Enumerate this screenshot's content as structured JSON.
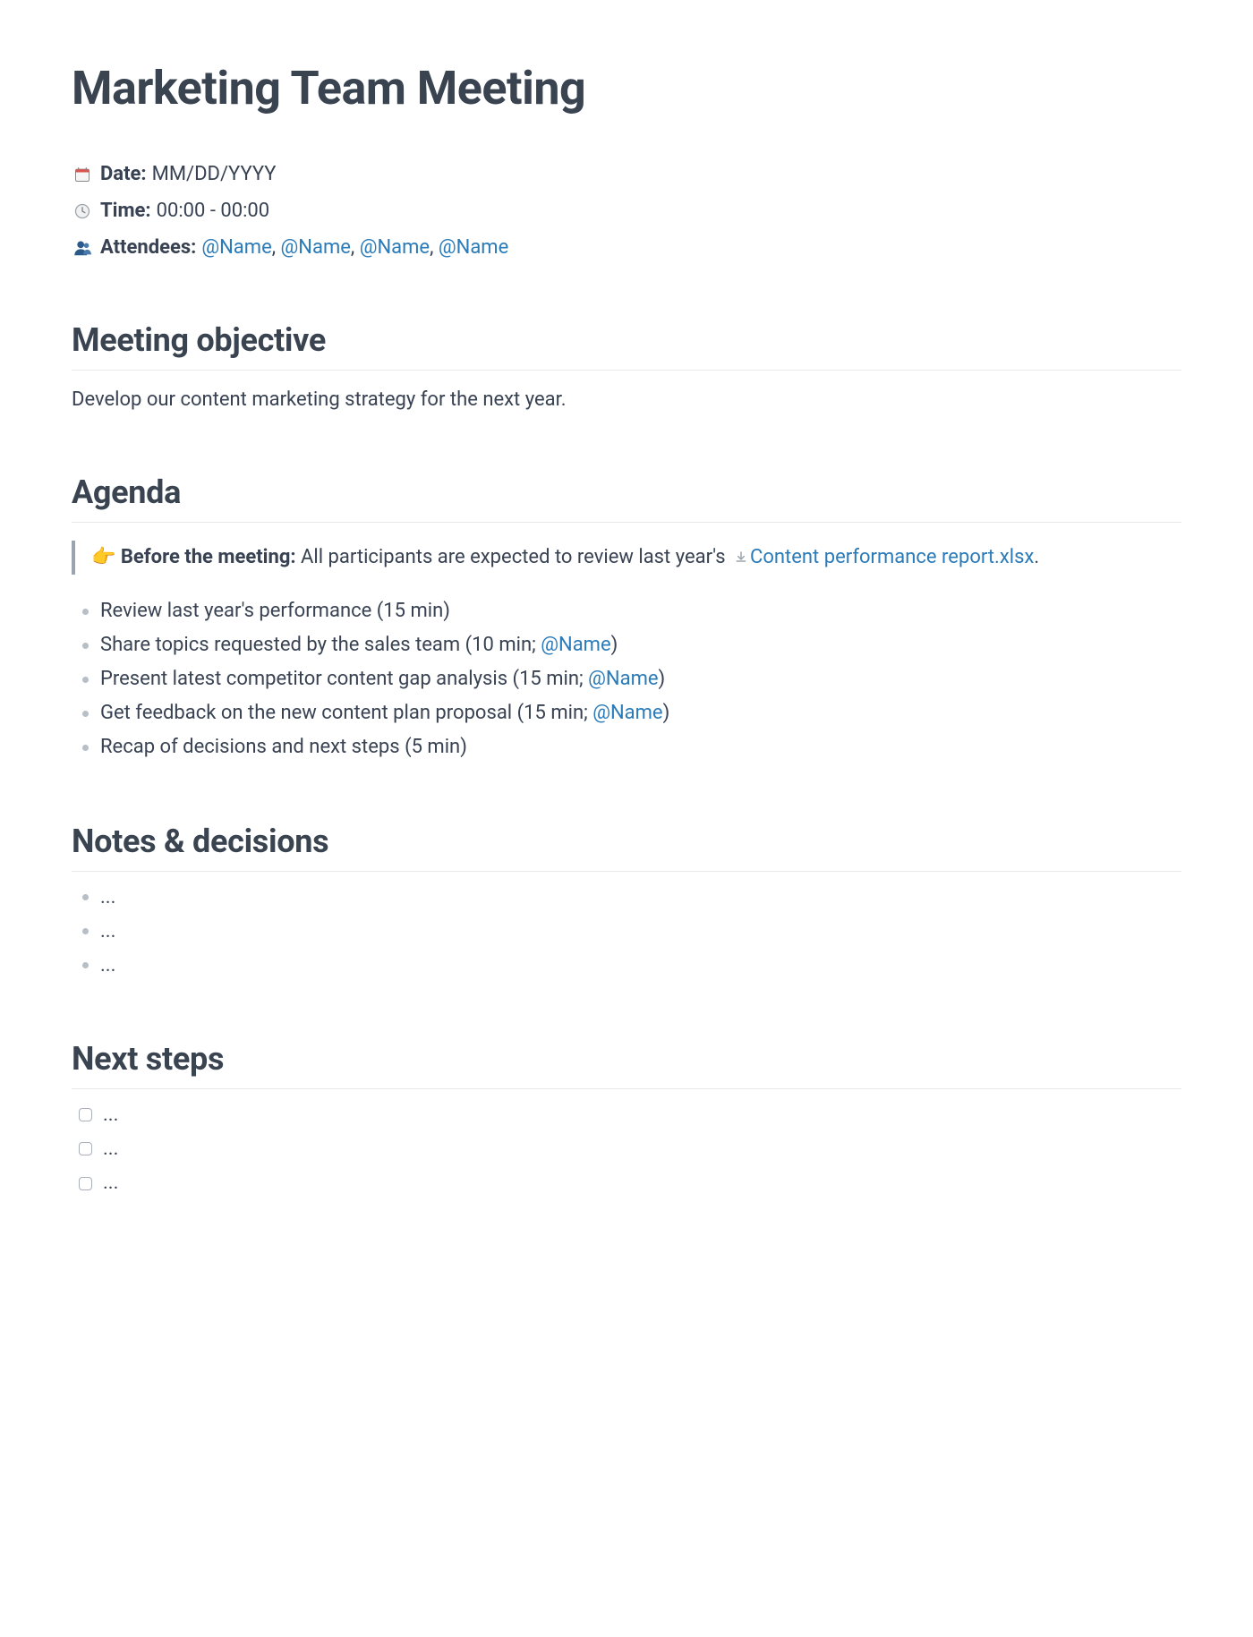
{
  "title": "Marketing Team Meeting",
  "meta": {
    "date_label": "Date:",
    "date_value": "MM/DD/YYYY",
    "time_label": "Time:",
    "time_value": "00:00 - 00:00",
    "attendees_label": "Attendees:",
    "attendees": [
      "@Name",
      "@Name",
      "@Name",
      "@Name"
    ]
  },
  "objective": {
    "heading": "Meeting objective",
    "text": "Develop our content marketing strategy for the next year."
  },
  "agenda": {
    "heading": "Agenda",
    "callout": {
      "emoji": "👉",
      "bold": "Before the meeting:",
      "text_before_link": " All participants are expected to review last year's ",
      "file_name": "Content performance report.xlsx",
      "text_after_link": "."
    },
    "items": [
      {
        "text": "Review last year's performance (15 min)"
      },
      {
        "text_before": "Share topics requested by the sales team (10 min; ",
        "mention": "@Name",
        "text_after": ")"
      },
      {
        "text_before": "Present latest competitor content gap analysis (15 min; ",
        "mention": "@Name",
        "text_after": ")"
      },
      {
        "text_before": "Get feedback on the new content plan proposal (15 min; ",
        "mention": "@Name",
        "text_after": ")"
      },
      {
        "text": "Recap of decisions and next steps (5 min)"
      }
    ]
  },
  "notes": {
    "heading": "Notes & decisions",
    "items": [
      "...",
      "...",
      "..."
    ]
  },
  "next_steps": {
    "heading": "Next steps",
    "items": [
      "...",
      "...",
      "..."
    ]
  },
  "icons": {
    "calendar": "calendar-icon",
    "clock": "clock-icon",
    "attendees": "silhouette-icon",
    "download": "download-icon",
    "pointing": "pointing-right-emoji"
  }
}
